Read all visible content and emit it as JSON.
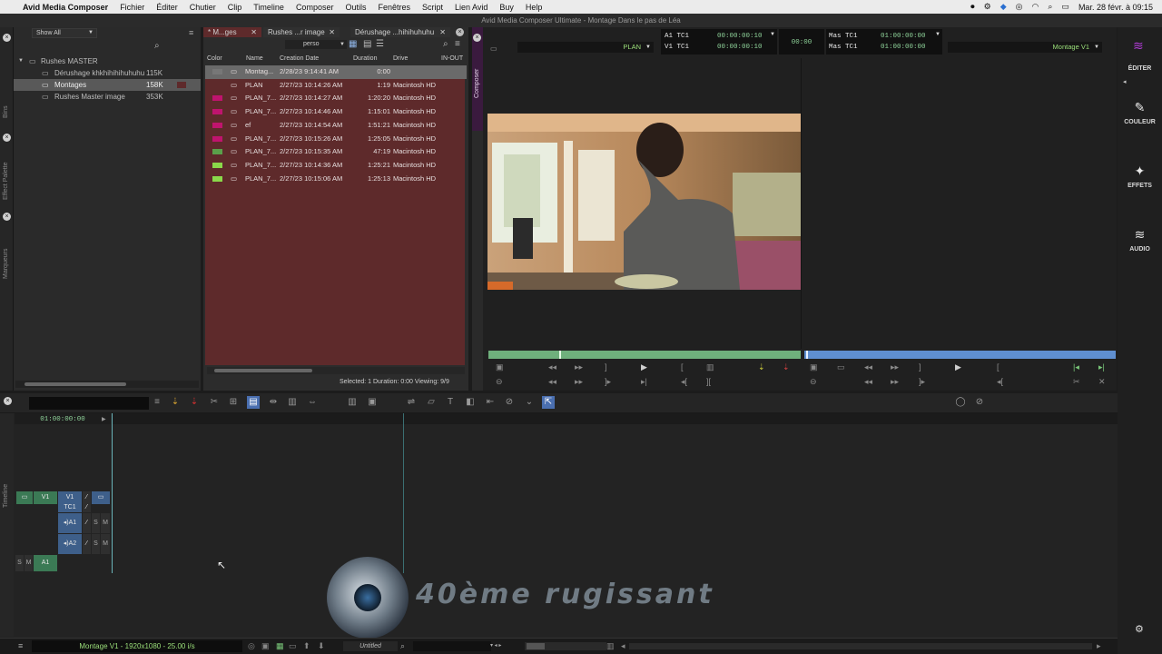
{
  "menubar": {
    "apple": "",
    "app_name": "Avid Media Composer",
    "items": [
      "Fichier",
      "Éditer",
      "Chutier",
      "Clip",
      "Timeline",
      "Composer",
      "Outils",
      "Fenêtres",
      "Script",
      "Lien Avid",
      "Buy",
      "Help"
    ],
    "datetime": "Mar. 28 févr. à 09:15"
  },
  "window_title": "Avid Media Composer Ultimate - Montage Dans le pas de Léa",
  "left_strip": {
    "labels": [
      "Bins",
      "Effect Palette",
      "Marqueurs"
    ]
  },
  "bin_list": {
    "filter": "Show All",
    "root": "Rushes MASTER",
    "items": [
      {
        "name": "Dérushage khkhihihihuhuhu",
        "size": "115K"
      },
      {
        "name": "Montages",
        "size": "158K"
      },
      {
        "name": "Rushes Master image",
        "size": "353K"
      }
    ]
  },
  "bin_panel": {
    "tabs": [
      "* M...ges",
      "Rushes ...r image",
      "Dérushage ...hihihuhuhu"
    ],
    "view_label": "perso",
    "columns": [
      "Color",
      "Name",
      "Creation Date",
      "Duration",
      "Drive",
      "IN-OUT"
    ],
    "rows": [
      {
        "name": "Montag...",
        "date": "2/28/23 9:14:41 AM",
        "duration": "0:00",
        "drive": "",
        "color": "#777777"
      },
      {
        "name": "PLAN",
        "date": "2/27/23 10:14:26 AM",
        "duration": "1:19",
        "drive": "Macintosh HD",
        "color": ""
      },
      {
        "name": "PLAN_7...",
        "date": "2/27/23 10:14:27 AM",
        "duration": "1:20:20",
        "drive": "Macintosh HD",
        "color": "#c0146e"
      },
      {
        "name": "PLAN_7...",
        "date": "2/27/23 10:14:46 AM",
        "duration": "1:15:01",
        "drive": "Macintosh HD",
        "color": "#c0146e"
      },
      {
        "name": "ef",
        "date": "2/27/23 10:14:54 AM",
        "duration": "1:51:21",
        "drive": "Macintosh HD",
        "color": "#c0146e"
      },
      {
        "name": "PLAN_7...",
        "date": "2/27/23 10:15:26 AM",
        "duration": "1:25:05",
        "drive": "Macintosh HD",
        "color": "#c0146e"
      },
      {
        "name": "PLAN_7...",
        "date": "2/27/23 10:15:35 AM",
        "duration": "47:19",
        "drive": "Macintosh HD",
        "color": "#5aa04a"
      },
      {
        "name": "PLAN_7...",
        "date": "2/27/23 10:14:36 AM",
        "duration": "1:25:21",
        "drive": "Macintosh HD",
        "color": "#8ad84a"
      },
      {
        "name": "PLAN_7...",
        "date": "2/27/23 10:15:06 AM",
        "duration": "1:25:13",
        "drive": "Macintosh HD",
        "color": "#8ad84a"
      }
    ],
    "status": "Selected: 1  Duration: 0:00  Viewing: 9/9"
  },
  "composer": {
    "side_label": "Composer",
    "source_name": "PLAN",
    "record_name": "Montage V1",
    "tc_left": [
      {
        "label": "A1  TC1",
        "value": "00:00:00:10"
      },
      {
        "label": "V1  TC1",
        "value": "00:00:00:10"
      }
    ],
    "tc_center": "00:00",
    "tc_right": [
      {
        "label": "Mas  TC1",
        "value": "01:00:00:00"
      },
      {
        "label": "Mas  TC1",
        "value": "01:00:00:00"
      }
    ]
  },
  "right_sidebar": {
    "items": [
      "ÉDITER",
      "COULEUR",
      "EFFETS",
      "AUDIO"
    ]
  },
  "timeline": {
    "side_label": "Timeline",
    "timecode": "01:00:00:00",
    "tracks": {
      "v1": "V1",
      "tc1": "TC1",
      "a1": "A1",
      "a2": "A2",
      "a1_src": "A1"
    },
    "status": "Montage V1 - 1920x1080 - 25.00 i/s",
    "untitled": "Untitled"
  },
  "watermark": {
    "text": "40ème rugissant"
  },
  "colors": {
    "accent": "#b23cd8",
    "bin_bg": "#5e2a2b",
    "track_blue": "#3e5f8a",
    "track_green": "#3b7a55"
  }
}
